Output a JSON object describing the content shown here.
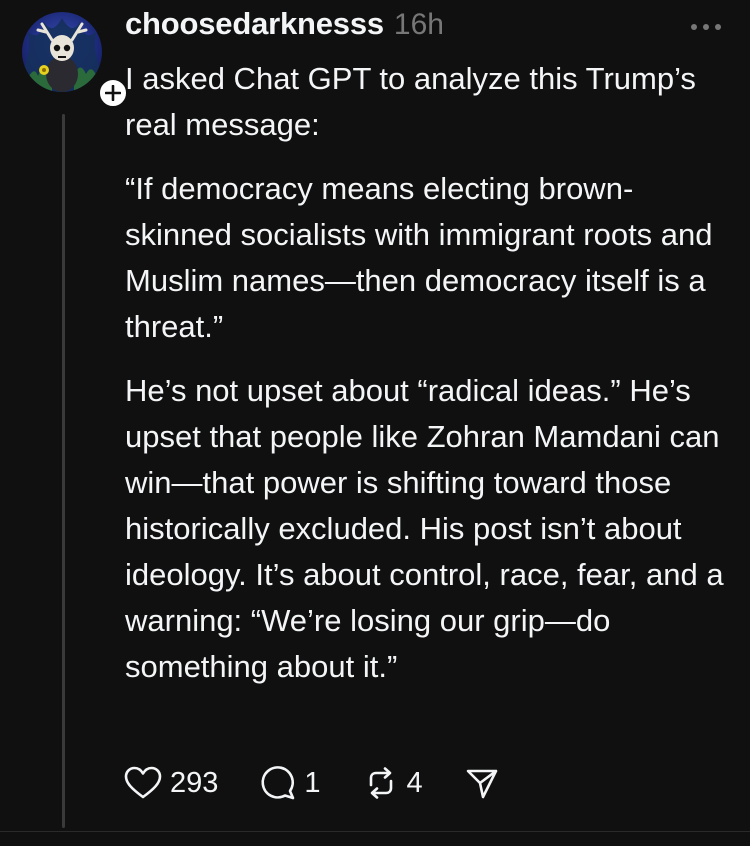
{
  "post": {
    "username": "choosedarknesss",
    "timestamp": "16h",
    "paragraphs": [
      "I asked Chat GPT to analyze this Trump’s real message:",
      "“If democracy means electing brown-skinned socialists with immigrant roots and Muslim names—then democracy itself is a threat.”",
      "He’s not upset about “radical ideas.” He’s upset that people like Zohran Mamdani can win—that power is shifting toward those historically excluded. His post isn’t about ideology. It’s about control, race, fear, and a warning: “We’re losing our grip—do something about it.”"
    ],
    "icons": {
      "more": "more-horizontal-icon",
      "follow": "plus-icon",
      "like": "heart-icon",
      "reply": "comment-icon",
      "repost": "repost-icon",
      "share": "send-icon"
    },
    "stats": {
      "likes": "293",
      "replies": "1",
      "reposts": "4"
    }
  },
  "colors": {
    "background": "#101010",
    "text": "#f3f5f7",
    "muted": "#777777",
    "thread_line": "#3a3a3a"
  }
}
